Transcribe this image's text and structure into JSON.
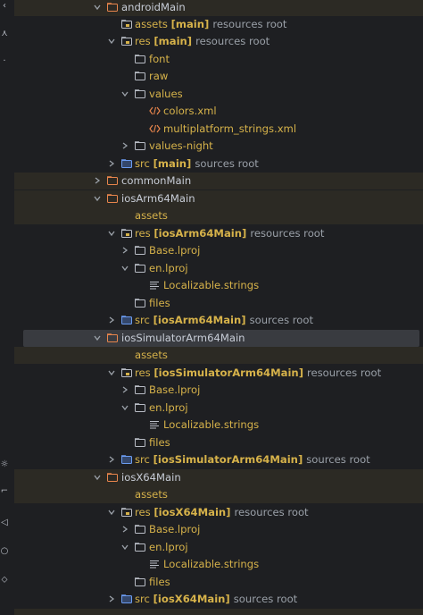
{
  "rows": [
    {
      "label": "androidMain",
      "suffix": "",
      "note": ""
    },
    {
      "label": "assets",
      "suffix": "[main]",
      "note": "resources root"
    },
    {
      "label": "res",
      "suffix": "[main]",
      "note": "resources root"
    },
    {
      "label": "font",
      "suffix": "",
      "note": ""
    },
    {
      "label": "raw",
      "suffix": "",
      "note": ""
    },
    {
      "label": "values",
      "suffix": "",
      "note": ""
    },
    {
      "label": "colors.xml",
      "suffix": "",
      "note": ""
    },
    {
      "label": "multiplatform_strings.xml",
      "suffix": "",
      "note": ""
    },
    {
      "label": "values-night",
      "suffix": "",
      "note": ""
    },
    {
      "label": "src",
      "suffix": "[main]",
      "note": "sources root"
    },
    {
      "label": "commonMain",
      "suffix": "",
      "note": ""
    },
    {
      "label": "iosArm64Main",
      "suffix": "",
      "note": ""
    },
    {
      "label": "assets",
      "suffix": "",
      "note": ""
    },
    {
      "label": "res",
      "suffix": "[iosArm64Main]",
      "note": "resources root"
    },
    {
      "label": "Base.lproj",
      "suffix": "",
      "note": ""
    },
    {
      "label": "en.lproj",
      "suffix": "",
      "note": ""
    },
    {
      "label": "Localizable.strings",
      "suffix": "",
      "note": ""
    },
    {
      "label": "files",
      "suffix": "",
      "note": ""
    },
    {
      "label": "src",
      "suffix": "[iosArm64Main]",
      "note": "sources root"
    },
    {
      "label": "iosSimulatorArm64Main",
      "suffix": "",
      "note": ""
    },
    {
      "label": "assets",
      "suffix": "",
      "note": ""
    },
    {
      "label": "res",
      "suffix": "[iosSimulatorArm64Main]",
      "note": "resources root"
    },
    {
      "label": "Base.lproj",
      "suffix": "",
      "note": ""
    },
    {
      "label": "en.lproj",
      "suffix": "",
      "note": ""
    },
    {
      "label": "Localizable.strings",
      "suffix": "",
      "note": ""
    },
    {
      "label": "files",
      "suffix": "",
      "note": ""
    },
    {
      "label": "src",
      "suffix": "[iosSimulatorArm64Main]",
      "note": "sources root"
    },
    {
      "label": "iosX64Main",
      "suffix": "",
      "note": ""
    },
    {
      "label": "assets",
      "suffix": "",
      "note": ""
    },
    {
      "label": "res",
      "suffix": "[iosX64Main]",
      "note": "resources root"
    },
    {
      "label": "Base.lproj",
      "suffix": "",
      "note": ""
    },
    {
      "label": "en.lproj",
      "suffix": "",
      "note": ""
    },
    {
      "label": "Localizable.strings",
      "suffix": "",
      "note": ""
    },
    {
      "label": "files",
      "suffix": "",
      "note": ""
    },
    {
      "label": "src",
      "suffix": "[iosX64Main]",
      "note": "sources root"
    }
  ],
  "gutter_icons": [
    "chevron-left-icon",
    "vcs-icon",
    "dot-icon",
    "debug-icon",
    "terminal-icon",
    "problems-icon",
    "git-icon",
    "services-icon"
  ],
  "colors": {
    "background": "#1e1f22",
    "module_highlight": "#2c2a24",
    "selection": "#393b40",
    "resource_folder": "#d6b24a",
    "module_folder": "#e8854c",
    "source_folder": "#6b9cf2"
  }
}
